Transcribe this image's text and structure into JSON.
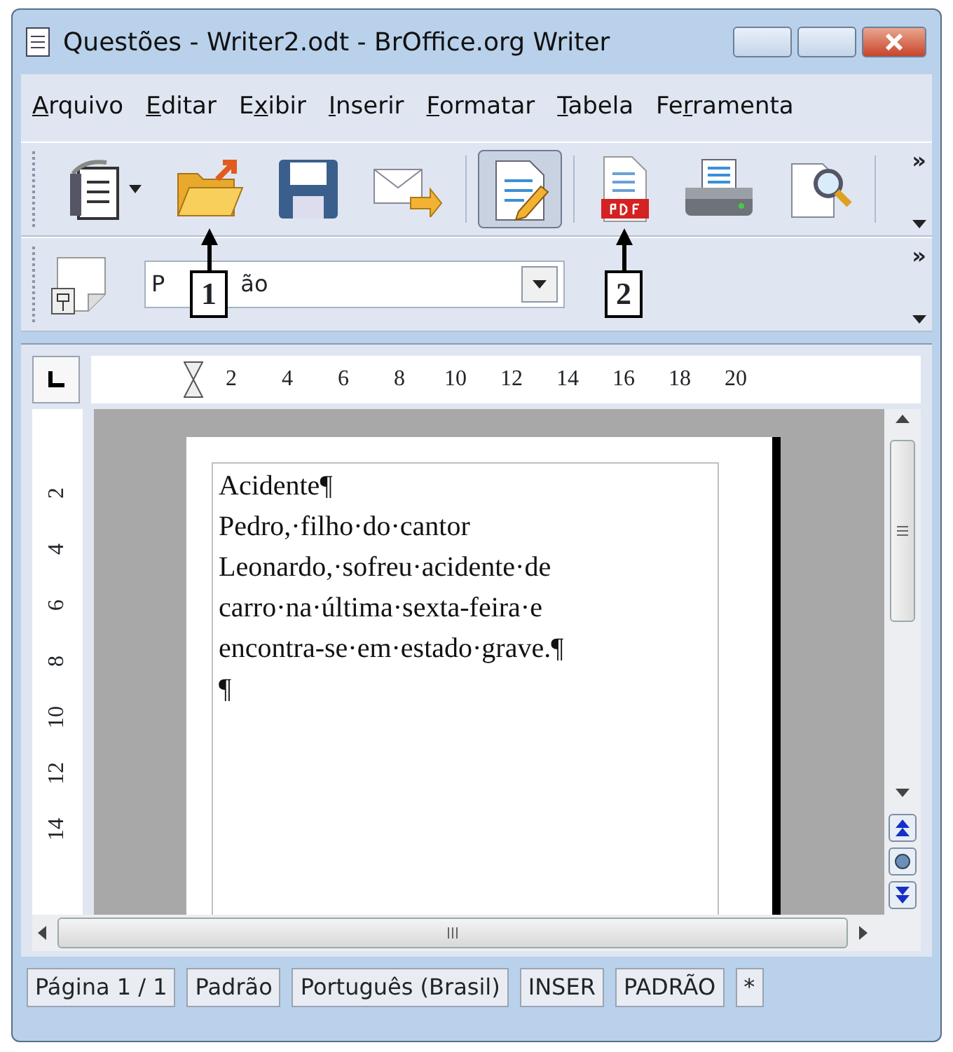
{
  "window": {
    "title": "Questões - Writer2.odt - BrOffice.org Writer"
  },
  "menu": [
    {
      "key": "A",
      "after": "rquivo"
    },
    {
      "key": "E",
      "after": "ditar"
    },
    {
      "before": "E",
      "key": "x",
      "after": "ibir"
    },
    {
      "key": "I",
      "after": "nserir"
    },
    {
      "key": "F",
      "after": "ormatar"
    },
    {
      "key": "T",
      "after": "abela"
    },
    {
      "before": "Fe",
      "key": "r",
      "after": "ramenta"
    }
  ],
  "standard_toolbar": {
    "overflow": "»",
    "items": [
      {
        "kind": "new",
        "pressed": false
      },
      {
        "kind": "open",
        "pressed": false,
        "callout": "1"
      },
      {
        "kind": "save",
        "pressed": false
      },
      {
        "kind": "mail",
        "pressed": false
      },
      {
        "kind": "edit",
        "pressed": true
      },
      {
        "kind": "pdf",
        "pressed": false,
        "callout": "2"
      },
      {
        "kind": "print",
        "pressed": false
      },
      {
        "kind": "preview",
        "pressed": false
      }
    ]
  },
  "formatting_toolbar": {
    "overflow": "»",
    "style_box": {
      "value_start": "P",
      "value_end": "ão"
    }
  },
  "ruler": {
    "horizontal": [
      "2",
      "4",
      "6",
      "8",
      "10",
      "12",
      "14",
      "16",
      "18",
      "20"
    ],
    "vertical": [
      "2",
      "4",
      "6",
      "8",
      "10",
      "12",
      "14"
    ]
  },
  "document": {
    "lines": [
      "Acidente¶",
      "Pedro,·filho·do·cantor",
      "Leonardo,·sofreu·acidente·de",
      "carro·na·última·sexta-feira·e",
      "encontra-se·em·estado·grave.¶",
      "¶"
    ]
  },
  "status_bar": [
    "Página 1 / 1",
    "Padrão",
    "Português (Brasil)",
    "INSER",
    "PADRÃO",
    "*"
  ]
}
